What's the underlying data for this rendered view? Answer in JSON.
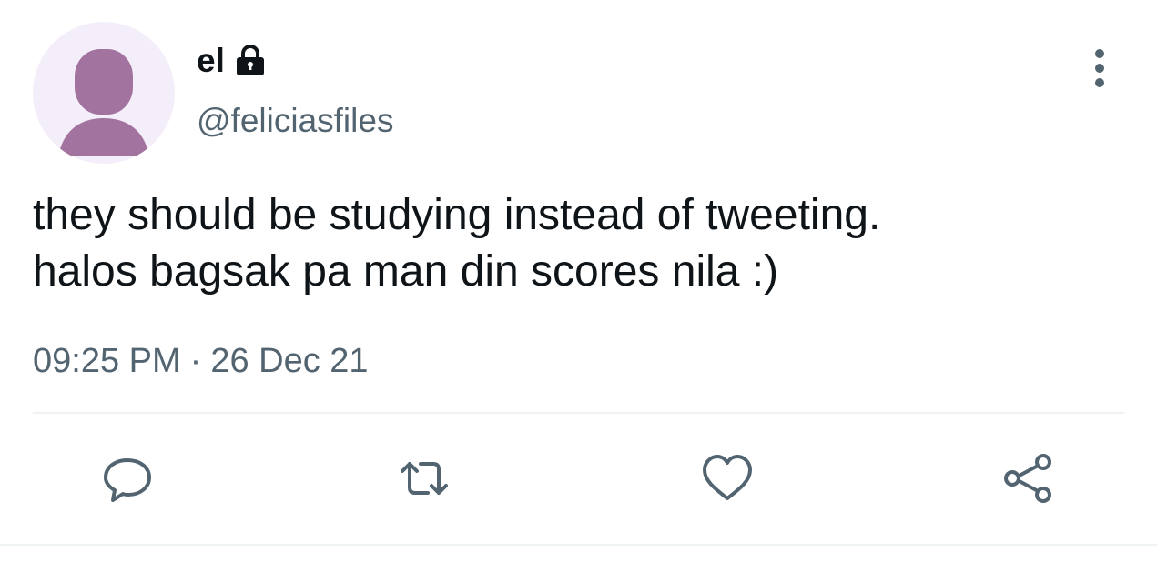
{
  "tweet": {
    "author": {
      "display_name": "el",
      "handle": "@feliciasfiles",
      "avatar_icon": "default-avatar-icon",
      "protected_icon": "lock-icon"
    },
    "text_lines": [
      "they should be studying instead of tweeting.",
      "halos bagsak pa man din scores nila :)"
    ],
    "time": "09:25 PM",
    "separator": "·",
    "date": "26 Dec 21"
  },
  "actions": [
    {
      "name": "reply",
      "icon": "reply-icon"
    },
    {
      "name": "retweet",
      "icon": "retweet-icon"
    },
    {
      "name": "like",
      "icon": "heart-icon"
    },
    {
      "name": "share",
      "icon": "share-icon"
    }
  ],
  "colors": {
    "text": "#0f1419",
    "secondary": "#536471",
    "avatar_bg": "#f4eefa",
    "avatar_fg": "#a3739f",
    "divider": "#eff3f4"
  }
}
